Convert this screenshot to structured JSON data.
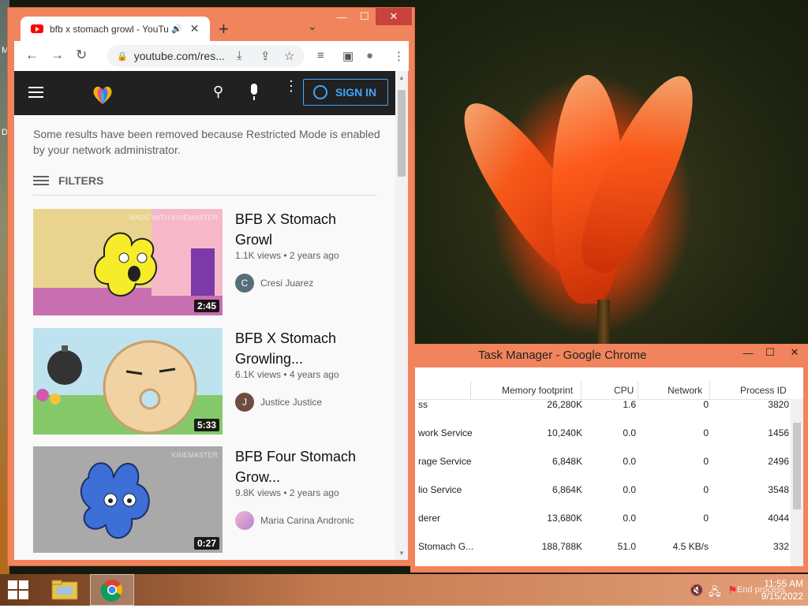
{
  "desktop": {
    "left_letters": [
      "M",
      "D"
    ]
  },
  "chrome": {
    "tab": {
      "title": "bfb x stomach growl - YouTube",
      "close": "✕",
      "audio_icon": "speaker-icon"
    },
    "new_tab": "+",
    "tab_menu": "⌄",
    "window_controls": {
      "minimize": "—",
      "maximize": "☐",
      "close": "✕"
    },
    "nav": {
      "back": "←",
      "forward": "→",
      "reload": "↻"
    },
    "omnibox": {
      "url": "youtube.com/res..."
    },
    "toolbar_icons": {
      "install": "⤓",
      "share": "⇪",
      "star": "☆",
      "media": "≡",
      "sidebar": "▣",
      "profile": "●",
      "menu": "⋮"
    }
  },
  "youtube": {
    "header": {
      "signin_label": "SIGN IN"
    },
    "restricted_notice": "Some results have been removed because Restricted Mode is enabled by your network administrator.",
    "filters_label": "FILTERS",
    "videos": [
      {
        "title": "BFB X Stomach Growl",
        "views": "1.1K views",
        "age": "2 years ago",
        "channel": "Cresi Juarez",
        "channel_initial": "C",
        "duration": "2:45",
        "watermark": "MADE WITH KINEMASTER"
      },
      {
        "title": "BFB X Stomach Growling...",
        "views": "6.1K views",
        "age": "4 years ago",
        "channel": "Justice Justice",
        "channel_initial": "J",
        "duration": "5:33",
        "watermark": ""
      },
      {
        "title": "BFB Four Stomach Grow...",
        "views": "9.8K views",
        "age": "2 years ago",
        "channel": "Maria Carina Andronic",
        "channel_initial": "",
        "duration": "0:27",
        "watermark": "KINEMASTER"
      }
    ],
    "separator": "•"
  },
  "task_manager": {
    "title": "Task Manager - Google Chrome",
    "window_controls": {
      "minimize": "—",
      "maximize": "☐",
      "close": "✕"
    },
    "columns": [
      "Memory footprint",
      "CPU",
      "Network",
      "Process ID"
    ],
    "rows": [
      {
        "task": "ss",
        "memory": "26,280K",
        "cpu": "1.6",
        "network": "0",
        "pid": "3820"
      },
      {
        "task": "work Service",
        "memory": "10,240K",
        "cpu": "0.0",
        "network": "0",
        "pid": "1456"
      },
      {
        "task": "rage Service",
        "memory": "6,848K",
        "cpu": "0.0",
        "network": "0",
        "pid": "2496"
      },
      {
        "task": "lio Service",
        "memory": "6,864K",
        "cpu": "0.0",
        "network": "0",
        "pid": "3548"
      },
      {
        "task": "derer",
        "memory": "13,680K",
        "cpu": "0.0",
        "network": "0",
        "pid": "4044"
      },
      {
        "task": "Stomach G...",
        "memory": "188,788K",
        "cpu": "51.0",
        "network": "4.5 KB/s",
        "pid": "332"
      }
    ]
  },
  "taskbar": {
    "tray_icons": [
      "volume-muted-icon",
      "network-icon",
      "flag-icon"
    ],
    "tray_glyphs": {
      "volume": "🔇",
      "network": "🖧",
      "flag": "⚑"
    },
    "end_process_label": "End process",
    "clock": {
      "time": "11:55 AM",
      "date": "9/15/2022"
    }
  }
}
